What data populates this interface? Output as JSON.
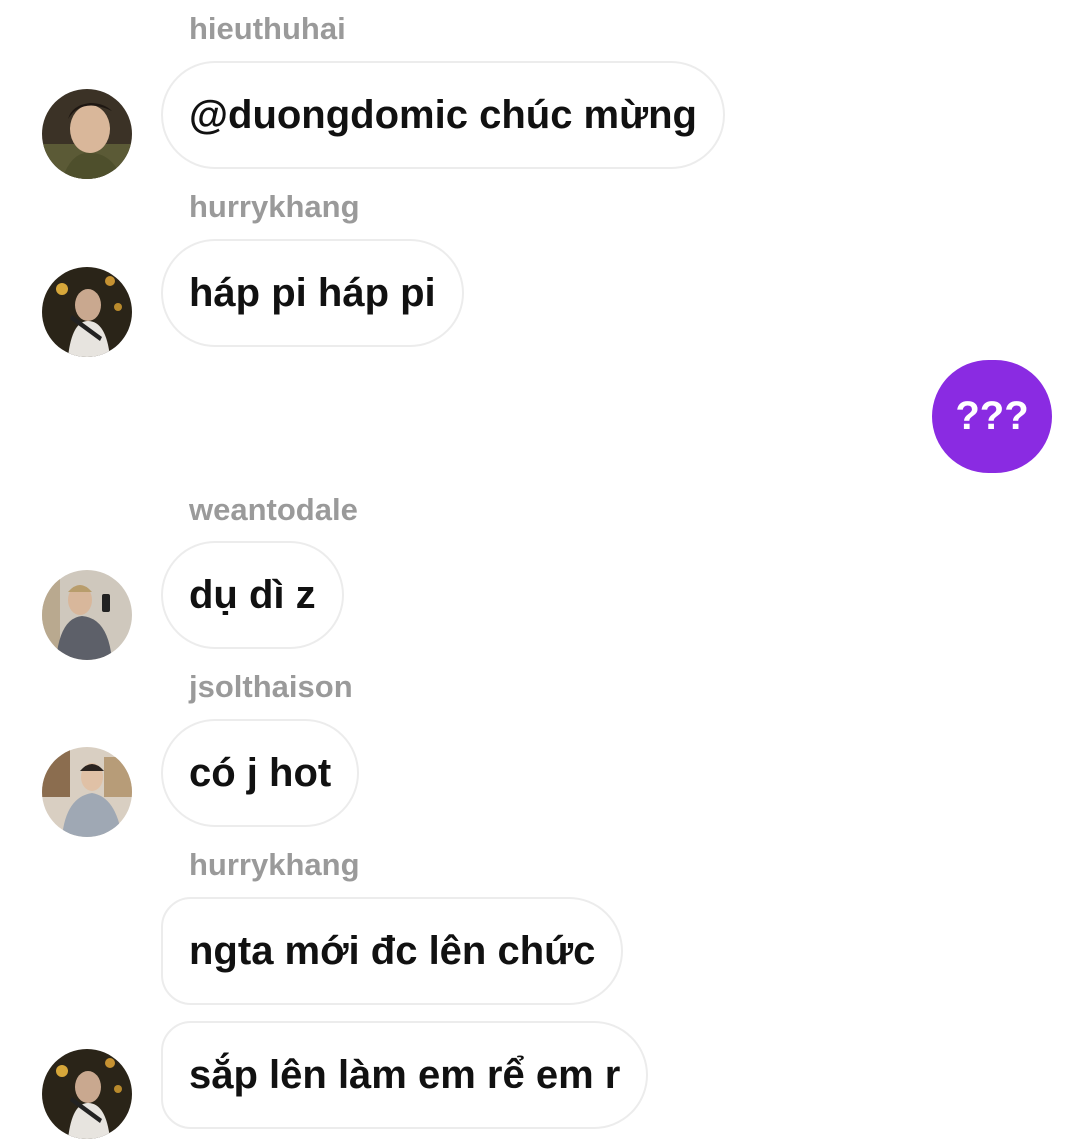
{
  "colors": {
    "sent_bubble": "#8a2be2",
    "username_text": "#9a9a9a",
    "message_text": "#111111",
    "bubble_border": "#ececec"
  },
  "messages": [
    {
      "sender": "hieuthuhai",
      "text": "@duongdomic chúc mừng",
      "avatar_icon": "user-avatar-icon"
    },
    {
      "sender": "hurrykhang",
      "text": "háp pi háp pi",
      "avatar_icon": "user-avatar-icon"
    },
    {
      "sender": "",
      "text": "???",
      "outgoing": true
    },
    {
      "sender": "weantodale",
      "text": "dụ dì z",
      "avatar_icon": "user-avatar-icon"
    },
    {
      "sender": "jsolthaison",
      "text": "có j hot",
      "avatar_icon": "user-avatar-icon"
    },
    {
      "sender": "hurrykhang",
      "text": "ngta mới đc lên chức"
    },
    {
      "sender": "",
      "text": "sắp lên làm em rể em r",
      "avatar_icon": "user-avatar-icon"
    }
  ]
}
